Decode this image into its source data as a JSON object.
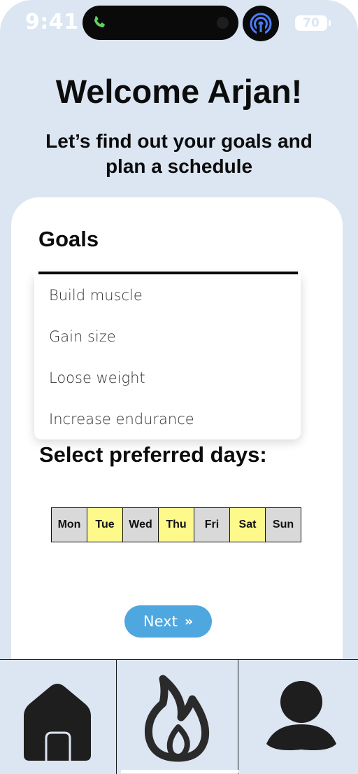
{
  "status_bar": {
    "time": "9:41",
    "battery": "70"
  },
  "header": {
    "title": "Welcome Arjan!",
    "subtitle": "Let’s find out your goals and plan a schedule"
  },
  "goals": {
    "label": "Goals",
    "options": [
      "Build muscle",
      "Gain size",
      "Loose weight",
      "Increase endurance"
    ]
  },
  "days": {
    "label": "Select preferred days:",
    "items": [
      {
        "label": "Mon",
        "selected": false
      },
      {
        "label": "Tue",
        "selected": true
      },
      {
        "label": "Wed",
        "selected": false
      },
      {
        "label": "Thu",
        "selected": true
      },
      {
        "label": "Fri",
        "selected": false
      },
      {
        "label": "Sat",
        "selected": true
      },
      {
        "label": "Sun",
        "selected": false
      }
    ],
    "selected_color": "#fdf98b",
    "unselected_color": "#d9d9d9"
  },
  "next_button": {
    "label": "Next",
    "icon": "double-chevron-right-icon",
    "color": "#4fa7e0"
  },
  "tabbar": {
    "tabs": [
      {
        "icon": "home-icon"
      },
      {
        "icon": "flame-icon",
        "active": true
      },
      {
        "icon": "profile-icon"
      }
    ]
  },
  "colors": {
    "background": "#dce6f2",
    "card": "#ffffff"
  }
}
